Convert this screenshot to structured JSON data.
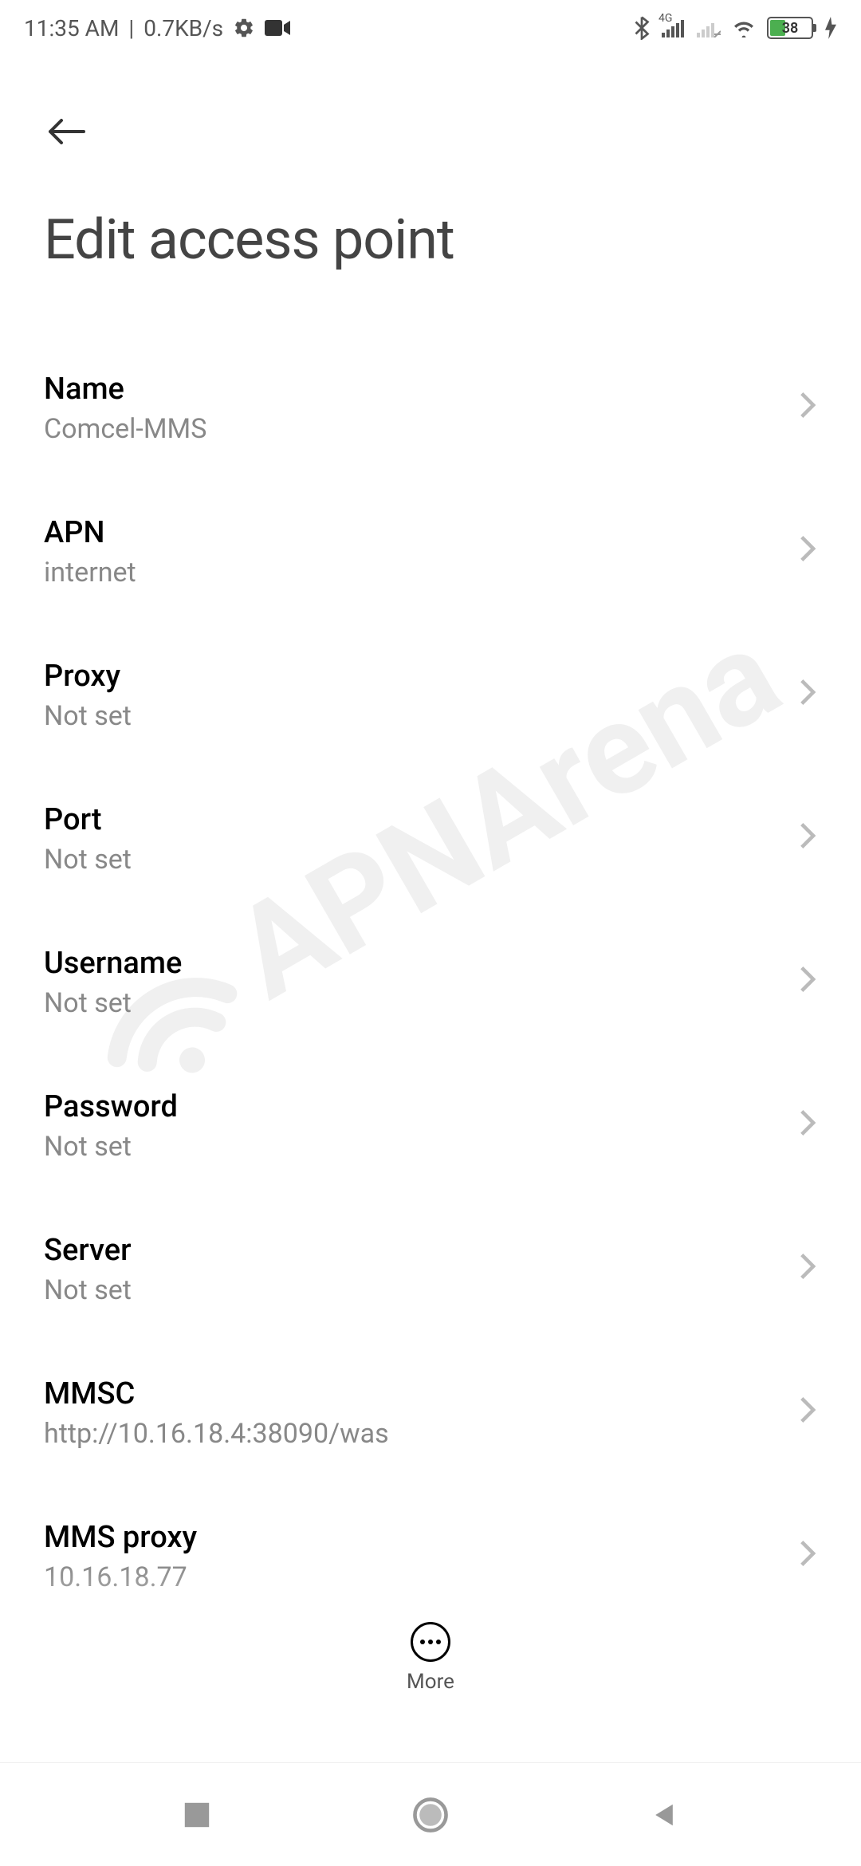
{
  "status": {
    "time": "11:35 AM",
    "speed": "0.7KB/s",
    "battery": "38",
    "network_label": "4G"
  },
  "header": {
    "title": "Edit access point"
  },
  "rows": [
    {
      "label": "Name",
      "value": "Comcel-MMS"
    },
    {
      "label": "APN",
      "value": "internet"
    },
    {
      "label": "Proxy",
      "value": "Not set"
    },
    {
      "label": "Port",
      "value": "Not set"
    },
    {
      "label": "Username",
      "value": "Not set"
    },
    {
      "label": "Password",
      "value": "Not set"
    },
    {
      "label": "Server",
      "value": "Not set"
    },
    {
      "label": "MMSC",
      "value": "http://10.16.18.4:38090/was"
    },
    {
      "label": "MMS proxy",
      "value": "10.16.18.77"
    }
  ],
  "more": {
    "label": "More"
  },
  "watermark": "APNArena"
}
